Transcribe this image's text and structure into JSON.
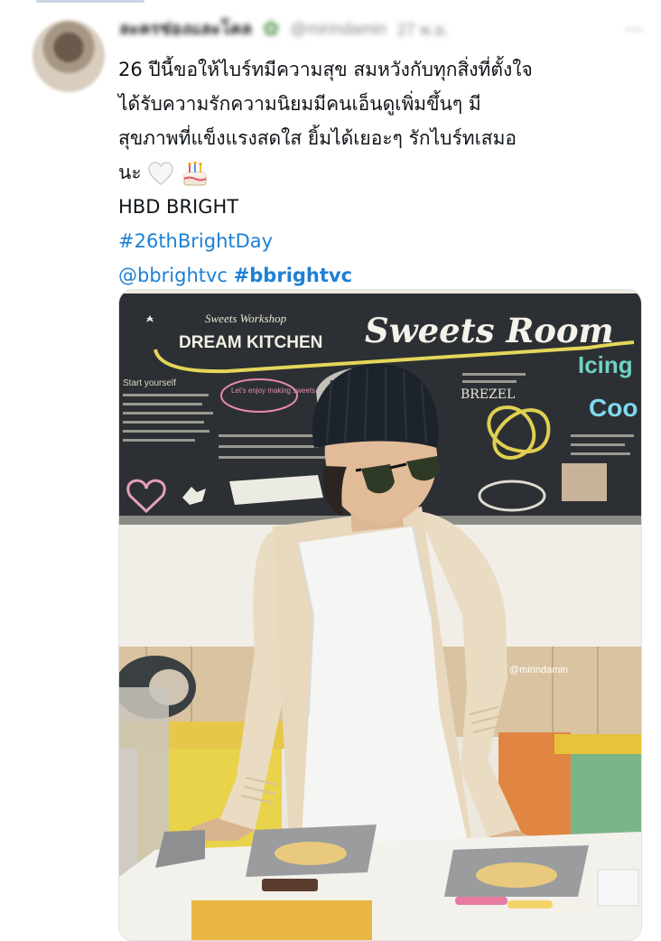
{
  "tweet": {
    "display_name": "ละครช่องและโคล",
    "handle": "@mirindamin",
    "time": "27 พ.ย.",
    "text_lines": [
      "26 ปีนี้ขอให้ไบร์ทมีความสุข สมหวังกับทุกสิ่งที่ตั้งใจ",
      "ได้รับความรักความนิยมมีคนเอ็นดูเพิ่มขึ้นๆ มี",
      "สุขภาพที่แข็งแรงสดใส ยิ้มได้เยอะๆ รักไบร์ทเสมอ",
      "นะ"
    ],
    "emoji": [
      "white-heart",
      "birthday-cake"
    ],
    "hbd_line": "HBD BRIGHT",
    "hashtag": "#26thBrightDay",
    "mention": "@bbrightvc",
    "hashtag2": "#bbrightvc"
  },
  "photo": {
    "board_small_title": "Sweets Workshop",
    "board_title": "DREAM KITCHEN",
    "board_script": "Sweets Room",
    "board_side_1": "Icing",
    "board_side_2": "Coo",
    "board_pretzel": "BREZEL",
    "board_bubble": "Let's enjoy making sweets",
    "board_intro": "Start yourself",
    "watermark": "@mirindamin",
    "colors": {
      "chalkboard": "#2c3034",
      "chalk_yellow": "#e4d65a",
      "sweater": "#eadcc3",
      "apron": "#f4f4f4",
      "beanie": "#1d232b"
    }
  }
}
